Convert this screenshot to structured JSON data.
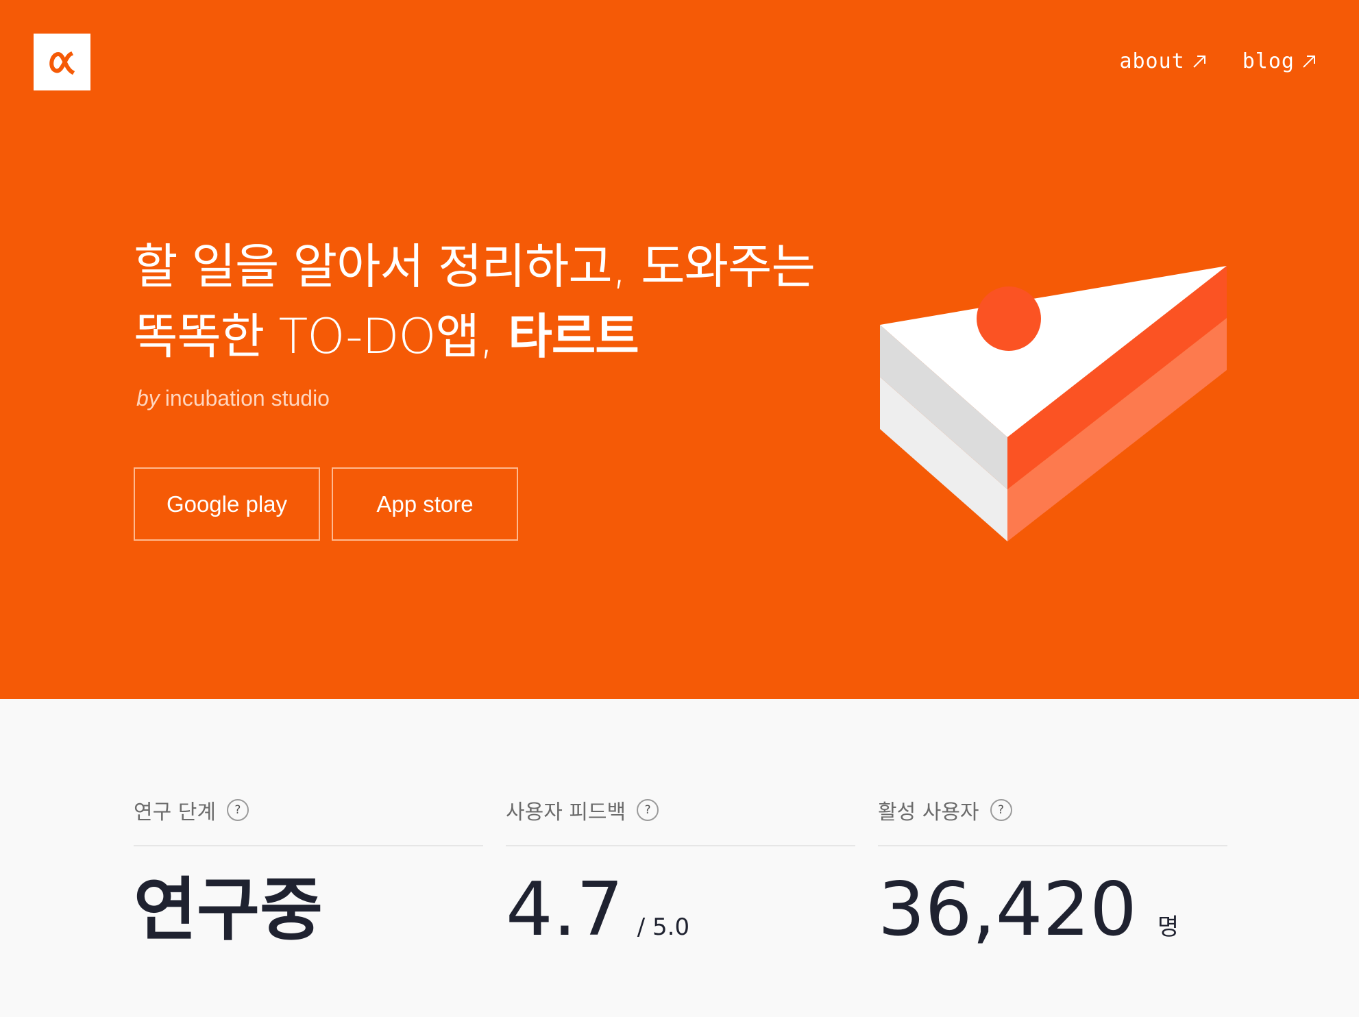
{
  "brand": {
    "logo_symbol": "α",
    "accent_color": "#f55a06"
  },
  "nav": {
    "items": [
      {
        "label": "about",
        "icon": "external-arrow-icon"
      },
      {
        "label": "blog",
        "icon": "external-arrow-icon"
      }
    ]
  },
  "hero": {
    "headline_line1": "할 일을 알아서 정리하고, 도와주는",
    "headline_line2_prefix": "똑똑한 TO-DO앱, ",
    "headline_brand": "타르트",
    "byline_prefix": "by",
    "byline_name": "incubation studio",
    "buttons": [
      {
        "label": "Google play"
      },
      {
        "label": "App store"
      }
    ],
    "illustration": "cake-slice-illustration"
  },
  "stats": [
    {
      "label": "연구 단계",
      "help": "?",
      "value": "연구중",
      "suffix": ""
    },
    {
      "label": "사용자 피드백",
      "help": "?",
      "value": "4.7",
      "suffix": "/ 5.0"
    },
    {
      "label": "활성 사용자",
      "help": "?",
      "value": "36,420",
      "suffix": "명"
    }
  ]
}
